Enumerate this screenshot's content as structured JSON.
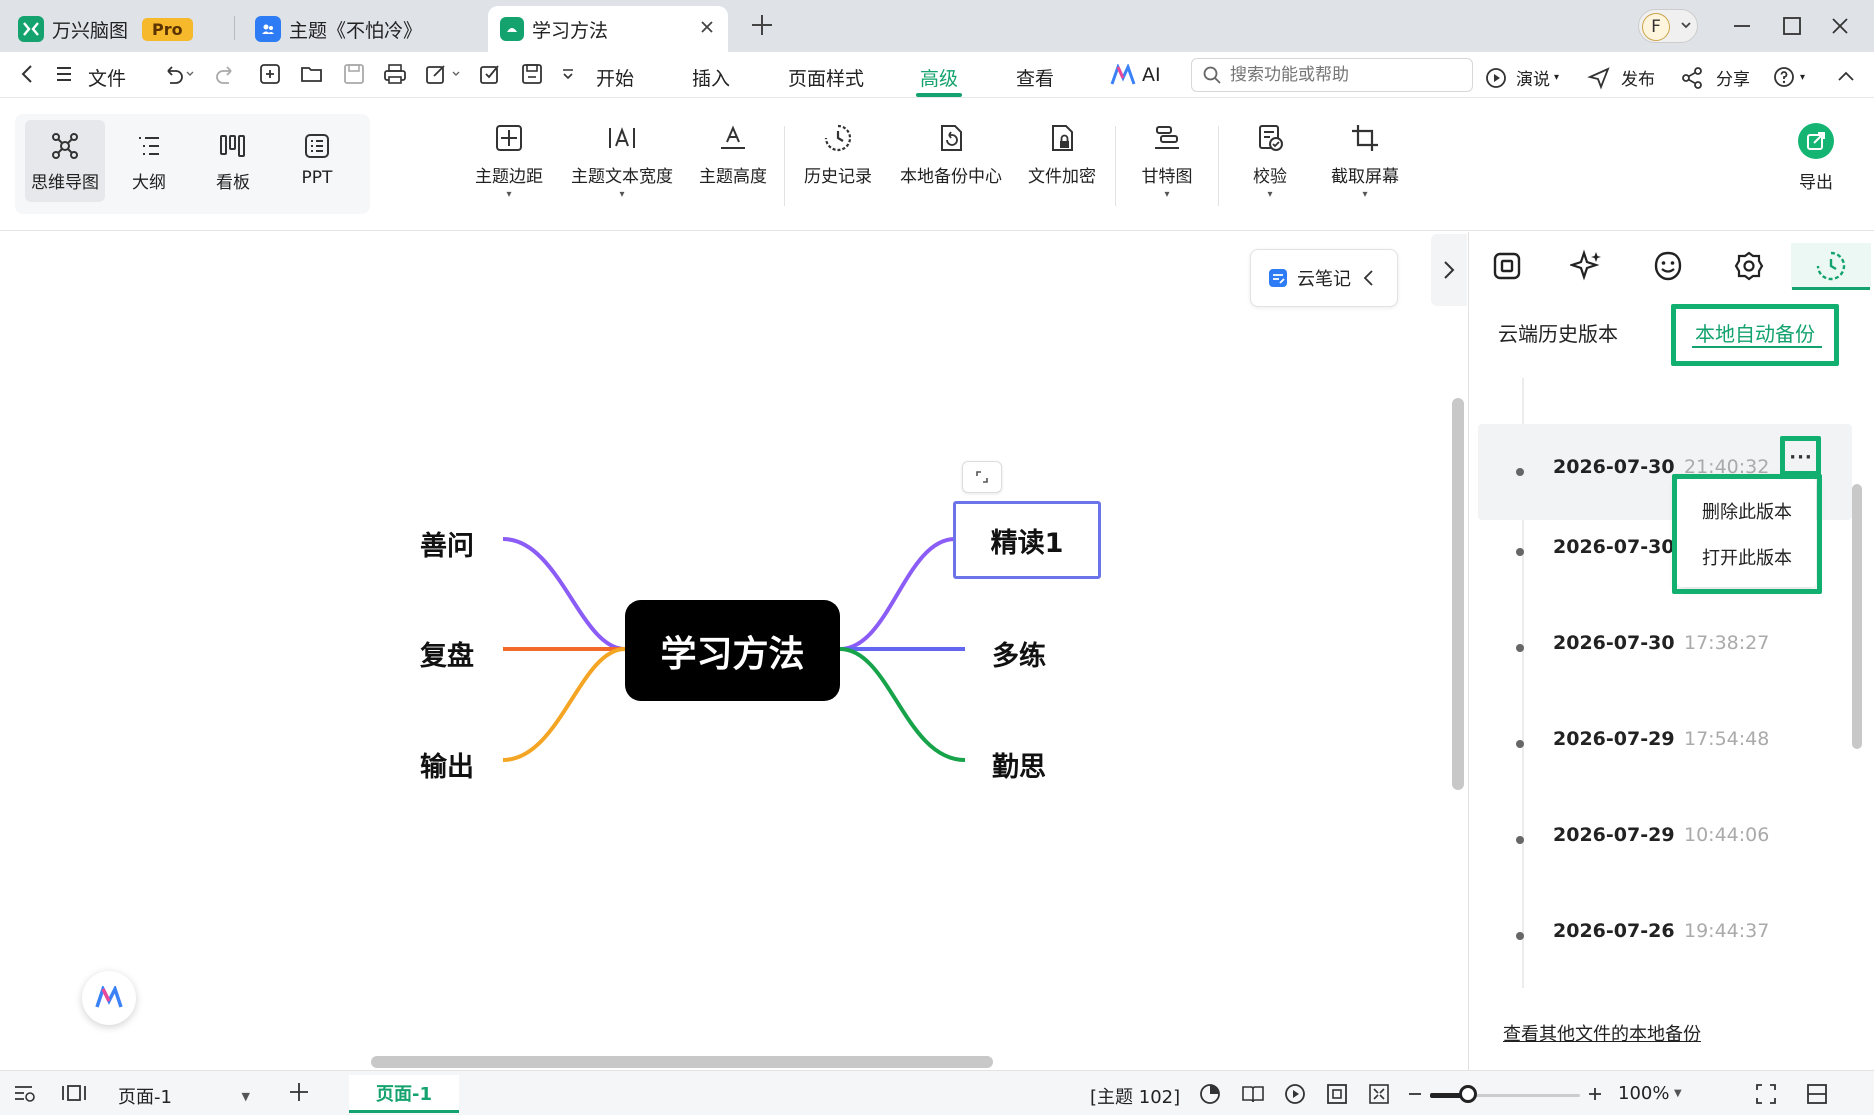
{
  "titlebar": {
    "tabs": [
      {
        "label": "万兴脑图",
        "badge": "Pro"
      },
      {
        "label": "主题《不怕冷》"
      },
      {
        "label": "学习方法"
      }
    ],
    "avatar_initial": "F"
  },
  "menubar": {
    "file": "文件",
    "items": [
      "开始",
      "插入",
      "页面样式",
      "高级",
      "查看"
    ],
    "active": "高级",
    "ai": "AI",
    "search_placeholder": "搜索功能或帮助",
    "present": "演说",
    "publish": "发布",
    "share": "分享"
  },
  "ribbon": {
    "views": [
      "思维导图",
      "大纲",
      "看板",
      "PPT"
    ],
    "tools": [
      "主题边距",
      "主题文本宽度",
      "主题高度",
      "历史记录",
      "本地备份中心",
      "文件加密",
      "甘特图",
      "校验",
      "截取屏幕"
    ],
    "export": "导出"
  },
  "canvas": {
    "cloud_note": "云笔记",
    "root": "学习方法",
    "left_nodes": [
      "善问",
      "复盘",
      "输出"
    ],
    "right_nodes": [
      "精读1",
      "多练",
      "勤思"
    ],
    "colors": {
      "purple": "#8b5cf6",
      "orange": "#f26a2a",
      "amber": "#f5a524",
      "blue": "#6366f1",
      "green": "#16a34a",
      "accent": "#14a36e"
    }
  },
  "panel": {
    "subtabs": [
      "云端历史版本",
      "本地自动备份"
    ],
    "active_subtab": "本地自动备份",
    "versions": [
      {
        "date": "2026-07-30",
        "time": "21:40:32"
      },
      {
        "date": "2026-07-30",
        "time": ""
      },
      {
        "date": "2026-07-30",
        "time": "17:38:27"
      },
      {
        "date": "2026-07-29",
        "time": "17:54:48"
      },
      {
        "date": "2026-07-29",
        "time": "10:44:06"
      },
      {
        "date": "2026-07-26",
        "time": "19:44:37"
      }
    ],
    "context_menu": [
      "删除此版本",
      "打开此版本"
    ],
    "other_backups": "查看其他文件的本地备份"
  },
  "statusbar": {
    "page_select": "页面-1",
    "page_tab": "页面-1",
    "topic_count": "[主题 102]",
    "zoom": "100%",
    "zoom_fraction": 0.25
  }
}
